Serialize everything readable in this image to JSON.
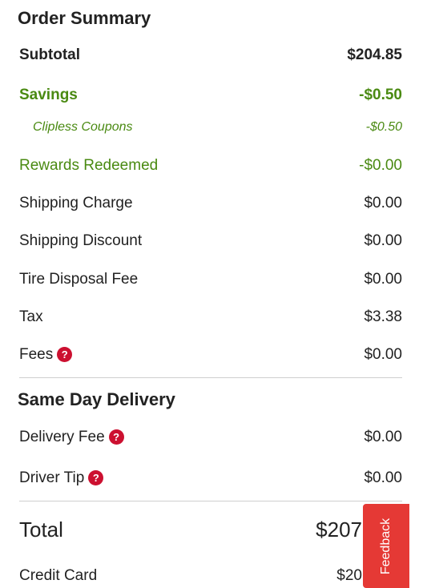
{
  "order_summary": {
    "title": "Order Summary",
    "subtotal": {
      "label": "Subtotal",
      "value": "$204.85"
    },
    "savings": {
      "label": "Savings",
      "value": "-$0.50"
    },
    "clipless": {
      "label": "Clipless Coupons",
      "value": "-$0.50"
    },
    "rewards": {
      "label": "Rewards Redeemed",
      "value": "-$0.00"
    },
    "shipping_charge": {
      "label": "Shipping Charge",
      "value": "$0.00"
    },
    "shipping_discount": {
      "label": "Shipping Discount",
      "value": "$0.00"
    },
    "tire_fee": {
      "label": "Tire Disposal Fee",
      "value": "$0.00"
    },
    "tax": {
      "label": "Tax",
      "value": "$3.38"
    },
    "fees": {
      "label": "Fees",
      "value": "$0.00"
    }
  },
  "same_day": {
    "title": "Same Day Delivery",
    "delivery_fee": {
      "label": "Delivery Fee",
      "value": "$0.00"
    },
    "driver_tip": {
      "label": "Driver Tip",
      "value": "$0.00"
    }
  },
  "total": {
    "label": "Total",
    "value": "$207"
  },
  "payment": {
    "label": "Credit Card",
    "value": "$20"
  },
  "feedback": {
    "label": "Feedback"
  },
  "icons": {
    "help": "question-circle-icon",
    "help_color": "#cc1030"
  },
  "colors": {
    "savings_green": "#4a8a12",
    "feedback_red": "#e53935"
  }
}
